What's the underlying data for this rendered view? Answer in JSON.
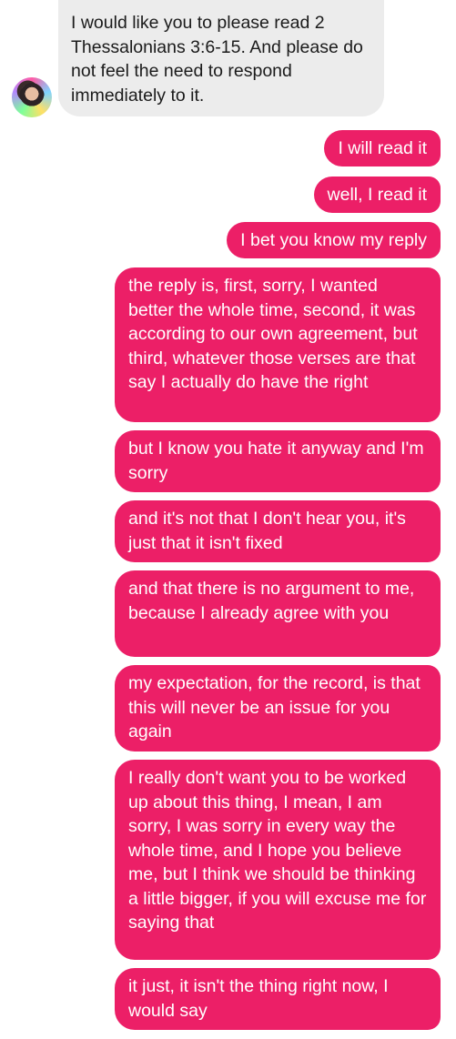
{
  "contact": {
    "avatar_icon": "profile-photo-avatar"
  },
  "colors": {
    "incoming_bubble": "#ececec",
    "outgoing_bubble": "#ec1f67",
    "incoming_text": "#1b1b1b",
    "outgoing_text": "#ffffff"
  },
  "messages": [
    {
      "direction": "incoming",
      "text": "I would like you to please read 2 Thessalonians 3:6-15. And please do not feel the need to respond immediately to it."
    },
    {
      "direction": "outgoing",
      "text": "I will read it"
    },
    {
      "direction": "outgoing",
      "text": "well, I read it"
    },
    {
      "direction": "outgoing",
      "text": "I bet you know my reply"
    },
    {
      "direction": "outgoing",
      "text": "the reply is, first, sorry, I wanted better the whole time, second, it was according to our own agreement, but third, whatever those verses are that say I actually do have the right"
    },
    {
      "direction": "outgoing",
      "text": "but I know you hate it anyway and I'm sorry"
    },
    {
      "direction": "outgoing",
      "text": "and it's not that I don't hear you, it's just that it isn't fixed"
    },
    {
      "direction": "outgoing",
      "text": "and that there is no argument to me, because I already agree with you"
    },
    {
      "direction": "outgoing",
      "text": "my expectation, for the record, is that this will never be an issue for you again"
    },
    {
      "direction": "outgoing",
      "text": "I really don't want you to be worked up about this thing, I mean, I am sorry, I was sorry in every way the whole time, and I hope you believe me, but I think we should be thinking a little bigger, if you will excuse me for saying that"
    },
    {
      "direction": "outgoing",
      "text": "it just, it isn't the thing right now, I would say"
    }
  ]
}
